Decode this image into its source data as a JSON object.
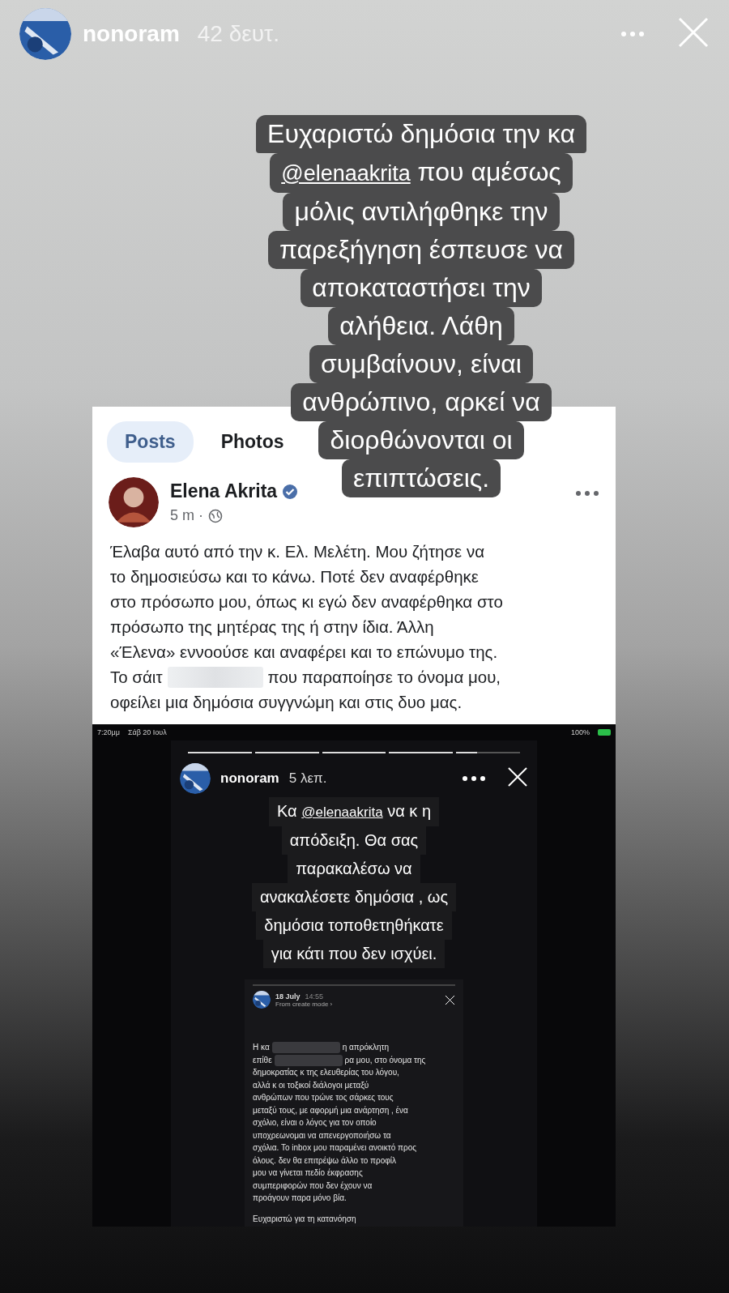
{
  "story": {
    "username": "nonoram",
    "time": "42 δευτ."
  },
  "sticker": {
    "lines": [
      {
        "text": "Ευχαριστώ δημόσια την κα"
      },
      {
        "mention": "@elenaakrita",
        "text": "που αμέσως"
      },
      {
        "text": "μόλις αντιλήφθηκε την"
      },
      {
        "text": "παρεξήγηση έσπευσε να"
      },
      {
        "text": "αποκαταστήσει την"
      },
      {
        "text": "αλήθεια. Λάθη"
      },
      {
        "text": "συμβαίνουν, είναι"
      },
      {
        "text": "ανθρώπινο, αρκεί να"
      },
      {
        "text": "διορθώνονται οι"
      },
      {
        "text": "επιπτώσεις."
      }
    ]
  },
  "post": {
    "tabs": [
      {
        "label": "Posts",
        "selected": true
      },
      {
        "label": "Photos",
        "selected": false
      }
    ],
    "author": "Elena Akrita",
    "verified": true,
    "time": "5 m ·",
    "lines": [
      {
        "text": "Έλαβα αυτό από την κ. Ελ. Μελέτη. Μου ζήτησε να"
      },
      {
        "text": "το δημοσιεύσω και το κάνω. Ποτέ δεν αναφέρθηκε"
      },
      {
        "text": "στο πρόσωπο μου, όπως κι εγώ δεν αναφέρθηκα στο"
      },
      {
        "text": "πρόσωπο της μητέρας της ή στην ίδια. Άλλη"
      },
      {
        "text": "«Έλενα» εννοούσε και αναφέρει και το επώνυμο της."
      },
      {
        "text": "Το σάιτ",
        "tail": "που παραποίησε το όνομα μου,"
      },
      {
        "text": "οφείλει μια δημόσια συγγνώμη και στις δυο μας."
      }
    ]
  },
  "screenshot": {
    "status": {
      "time": "7:20μμ",
      "date": "Σάβ 20 Ιουλ",
      "battery": "100%"
    },
    "story": {
      "segments": [
        {
          "level": 1
        },
        {
          "level": 1
        },
        {
          "level": 1
        },
        {
          "level": 1
        },
        {
          "level": 0.33
        }
      ],
      "username": "nonoram",
      "time": "5 λεπ.",
      "caption": [
        {
          "text": "να κ η",
          "mention": "@elenaakrita",
          "lead": "Κα"
        },
        {
          "text": "απόδειξη. Θα σας"
        },
        {
          "text": "παρακαλέσω να"
        },
        {
          "text": "ανακαλέσετε δημόσια , ως"
        },
        {
          "text": "δημόσια τοποθετηθήκατε"
        },
        {
          "text": "για κάτι που δεν ισχύει."
        }
      ],
      "inner": {
        "date": "18 July",
        "time": "14:55",
        "source": "From create mode ›",
        "lines": [
          {
            "text": "Η κα",
            "tail": "η απρόκλητη"
          },
          {
            "text": "επίθε",
            "tail": "ρα μου, στο όνομα της"
          },
          {
            "text": "δημοκρατίας κ της ελευθερίας του λόγου,"
          },
          {
            "text": "αλλά κ οι τοξικοί διάλογοι μεταξύ"
          },
          {
            "text": "ανθρώπων που τρώνε τος σάρκες τους"
          },
          {
            "text": "μεταξύ τους, με αφορμή μια ανάρτηση , ένα"
          },
          {
            "text": "σχόλιο, είναι ο λόγος για τον οποίο"
          },
          {
            "text": "υποχρεωνομαι να απενεργοποιήσω τα"
          },
          {
            "text": "σχόλια. Το inbox μου παραμένει ανοικτό προς"
          },
          {
            "text": "όλους. δεν θα επιτρέψω άλλο το προφίλ"
          },
          {
            "text": "μου να γίνεται πεδίο έκφρασης"
          },
          {
            "text": "συμπεριφορών που δεν έχουν να"
          },
          {
            "text": "προάγουν παρα μόνο βία."
          }
        ],
        "closing": "Ευχαριστώ για τη κατανόηση"
      }
    }
  }
}
